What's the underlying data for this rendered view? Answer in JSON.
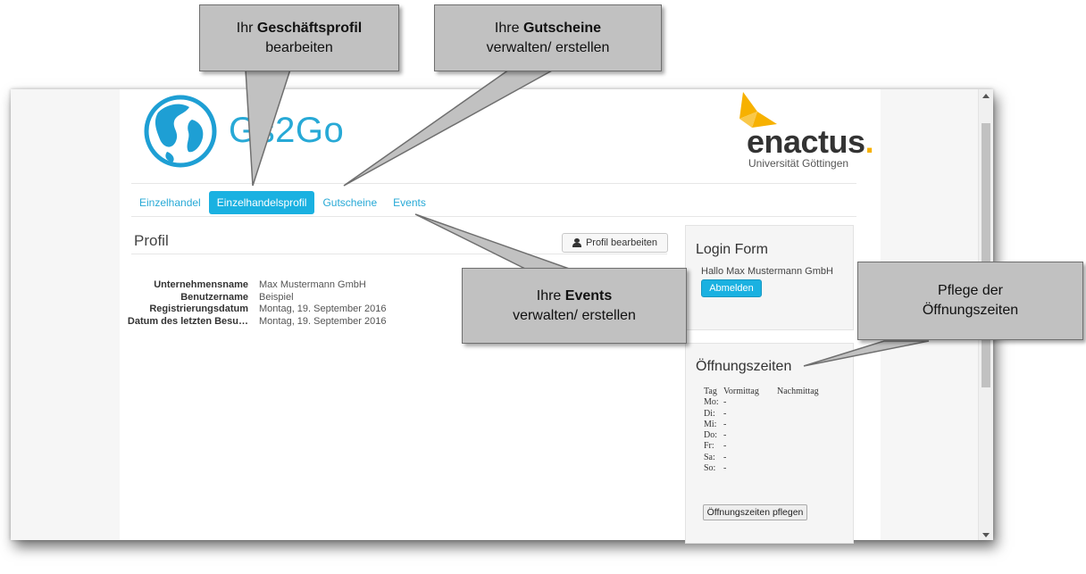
{
  "logo": {
    "text": "Gs2Go",
    "partner_name": "enactus",
    "partner_sub": "Universität Göttingen"
  },
  "nav": [
    {
      "label": "Einzelhandel",
      "active": false
    },
    {
      "label": "Einzelhandelsprofil",
      "active": true
    },
    {
      "label": "Gutscheine",
      "active": false
    },
    {
      "label": "Events",
      "active": false
    }
  ],
  "profile": {
    "title": "Profil",
    "edit_button": "Profil bearbeiten",
    "fields": [
      {
        "label": "Unternehmensname",
        "value": "Max Mustermann GmbH"
      },
      {
        "label": "Benutzername",
        "value": "Beispiel"
      },
      {
        "label": "Registrierungsdatum",
        "value": "Montag, 19. September 2016"
      },
      {
        "label": "Datum des letzten Besu…",
        "value": "Montag, 19. September 2016"
      }
    ]
  },
  "login": {
    "title": "Login Form",
    "greeting": "Hallo Max Mustermann GmbH",
    "logout_button": "Abmelden"
  },
  "hours": {
    "title": "Öffnungszeiten",
    "headers": [
      "Tag",
      "Vormittag",
      "Nachmittag"
    ],
    "rows": [
      {
        "day": "Mo:",
        "am": "-",
        "pm": ""
      },
      {
        "day": "Di:",
        "am": "-",
        "pm": ""
      },
      {
        "day": "Mi:",
        "am": "-",
        "pm": ""
      },
      {
        "day": "Do:",
        "am": "-",
        "pm": ""
      },
      {
        "day": "Fr:",
        "am": "-",
        "pm": ""
      },
      {
        "day": "Sa:",
        "am": "-",
        "pm": ""
      },
      {
        "day": "So:",
        "am": "-",
        "pm": ""
      }
    ],
    "edit_button": "Öffnungszeiten pflegen"
  },
  "callouts": {
    "profile": {
      "pre": "Ihr ",
      "bold": "Geschäftsprofil",
      "line2": "bearbeiten"
    },
    "vouchers": {
      "pre": "Ihre ",
      "bold": "Gutscheine",
      "line2": "verwalten/ erstellen"
    },
    "events": {
      "pre": "Ihre ",
      "bold": "Events",
      "line2": "verwalten/ erstellen"
    },
    "hours": {
      "line1": "Pflege der",
      "line2": "Öffnungszeiten"
    }
  },
  "colors": {
    "accent": "#1ab1e1",
    "link": "#27a9d6",
    "callout_fill": "#c1c1c1",
    "enactus_yellow": "#f7b100"
  }
}
